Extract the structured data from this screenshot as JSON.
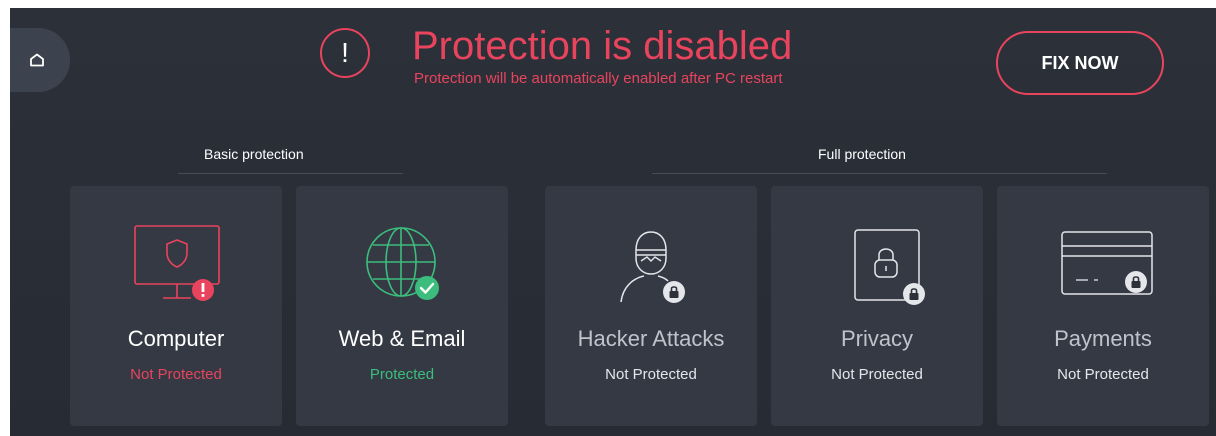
{
  "banner": {
    "title": "Protection is disabled",
    "subtitle": "Protection will be automatically enabled after PC restart",
    "alert_glyph": "!",
    "fix_button": "FIX NOW"
  },
  "sections": {
    "basic": "Basic protection",
    "full": "Full protection"
  },
  "cards": [
    {
      "name": "Computer",
      "status": "Not Protected",
      "icon": "monitor-shield-icon",
      "badge": "warning-badge-icon",
      "status_color": "#e8445d"
    },
    {
      "name": "Web & Email",
      "status": "Protected",
      "icon": "globe-icon",
      "badge": "check-badge-icon",
      "status_color": "#3dbd7d"
    },
    {
      "name": "Hacker Attacks",
      "status": "Not Protected",
      "icon": "hacker-icon",
      "badge": "lock-badge-icon"
    },
    {
      "name": "Privacy",
      "status": "Not Protected",
      "icon": "privacy-lock-icon",
      "badge": "lock-badge-icon"
    },
    {
      "name": "Payments",
      "status": "Not Protected",
      "icon": "credit-card-icon",
      "badge": "lock-badge-icon"
    }
  ],
  "colors": {
    "alert": "#e8445d",
    "ok": "#3dbd7d",
    "background": "#2c3039",
    "card": "#343944"
  }
}
